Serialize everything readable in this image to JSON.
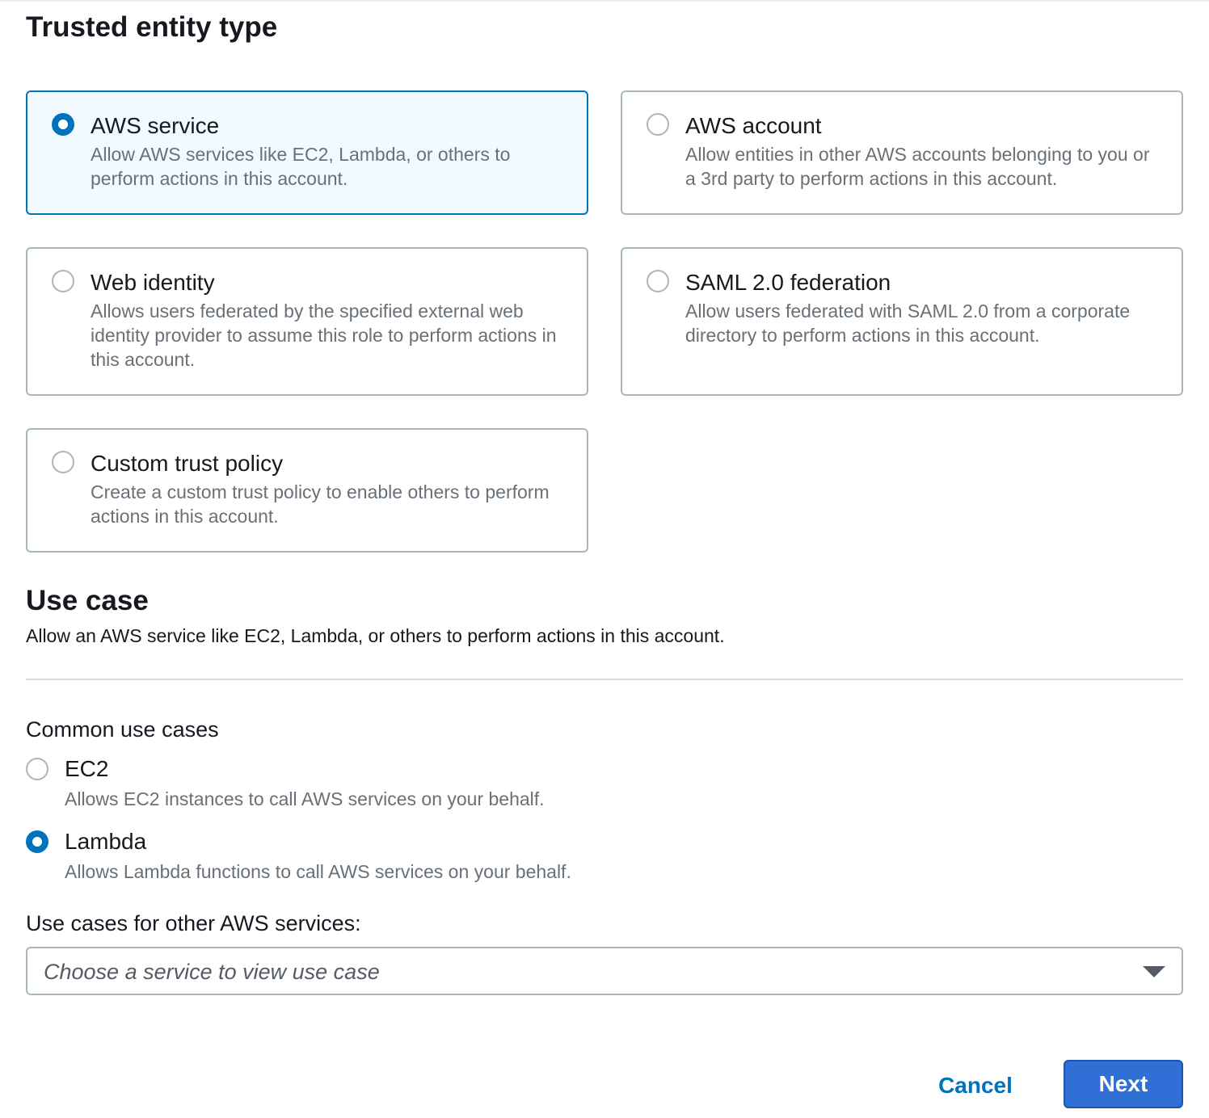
{
  "trusted_entity": {
    "title": "Trusted entity type",
    "options": [
      {
        "label": "AWS service",
        "description": "Allow AWS services like EC2, Lambda, or others to perform actions in this account.",
        "selected": true
      },
      {
        "label": "AWS account",
        "description": "Allow entities in other AWS accounts belonging to you or a 3rd party to perform actions in this account.",
        "selected": false
      },
      {
        "label": "Web identity",
        "description": "Allows users federated by the specified external web identity provider to assume this role to perform actions in this account.",
        "selected": false
      },
      {
        "label": "SAML 2.0 federation",
        "description": "Allow users federated with SAML 2.0 from a corporate directory to perform actions in this account.",
        "selected": false
      },
      {
        "label": "Custom trust policy",
        "description": "Create a custom trust policy to enable others to perform actions in this account.",
        "selected": false
      }
    ]
  },
  "use_case": {
    "title": "Use case",
    "description": "Allow an AWS service like EC2, Lambda, or others to perform actions in this account.",
    "common_label": "Common use cases",
    "common": [
      {
        "label": "EC2",
        "description": "Allows EC2 instances to call AWS services on your behalf.",
        "selected": false
      },
      {
        "label": "Lambda",
        "description": "Allows Lambda functions to call AWS services on your behalf.",
        "selected": true
      }
    ],
    "other_label": "Use cases for other AWS services:",
    "other_select_placeholder": "Choose a service to view use case"
  },
  "footer": {
    "cancel_label": "Cancel",
    "next_label": "Next"
  },
  "colors": {
    "selected_border": "#0073bb",
    "selected_bg": "#f1faff",
    "primary_button": "#2f6fd6",
    "link": "#0073bb"
  }
}
